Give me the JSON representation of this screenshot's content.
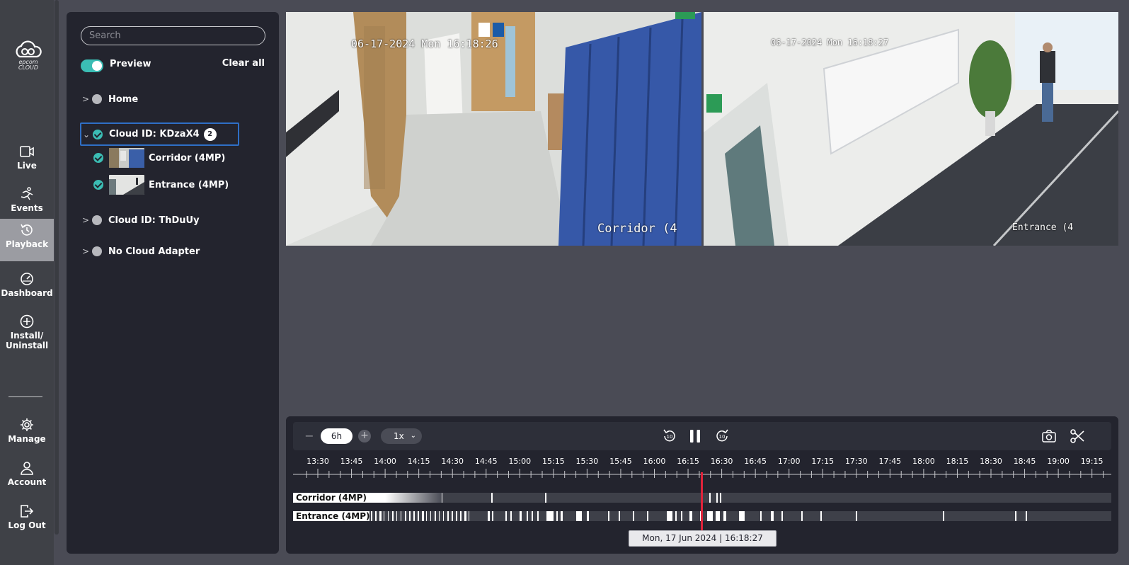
{
  "app": {
    "logo_text": "epcom CLOUD"
  },
  "nav": {
    "items": [
      {
        "label": "Live",
        "icon": "camera-icon"
      },
      {
        "label": "Events",
        "icon": "running-person-icon"
      },
      {
        "label": "Playback",
        "icon": "history-icon",
        "active": true
      },
      {
        "label": "Dashboard",
        "icon": "gauge-icon"
      },
      {
        "label": "Install/ Uninstall",
        "icon": "plus-circle-icon"
      },
      {
        "label": "Manage",
        "icon": "gear-icon"
      },
      {
        "label": "Account",
        "icon": "user-icon"
      },
      {
        "label": "Log Out",
        "icon": "logout-icon"
      }
    ]
  },
  "panel": {
    "search_placeholder": "Search",
    "preview_label": "Preview",
    "preview_on": true,
    "clear_all": "Clear all",
    "groups": [
      {
        "label": "Home",
        "expanded": false,
        "checked": false
      },
      {
        "label": "Cloud ID: KDzaX4",
        "expanded": true,
        "checked": true,
        "count": "2"
      },
      {
        "label": "Cloud ID: ThDuUy",
        "expanded": false,
        "checked": false
      },
      {
        "label": "No Cloud Adapter",
        "expanded": false,
        "checked": false
      }
    ],
    "cameras": [
      {
        "label": "Corridor (4MP)",
        "checked": true
      },
      {
        "label": "Entrance (4MP)",
        "checked": true
      }
    ]
  },
  "tiles": [
    {
      "timestamp": "06-17-2024 Mon 16:18:26",
      "name_overlay": "Corridor (4"
    },
    {
      "timestamp": "06-17-2024 Mon 16:18:27",
      "name_overlay": "Entrance (4"
    }
  ],
  "timeline": {
    "zoom": "6h",
    "speed": "1x",
    "ticks": [
      "13:30",
      "13:45",
      "14:00",
      "14:15",
      "14:30",
      "14:45",
      "15:00",
      "15:15",
      "15:30",
      "15:45",
      "16:00",
      "16:15",
      "16:30",
      "16:45",
      "17:00",
      "17:15",
      "17:30",
      "17:45",
      "18:00",
      "18:15",
      "18:30",
      "18:45",
      "19:00",
      "19:15"
    ],
    "tracks": [
      {
        "label": "Corridor (4MP)"
      },
      {
        "label": "Entrance (4MP)"
      }
    ],
    "current_time": "Mon, 17 Jun 2024 | 16:18:27",
    "playhead_color": "#e0243b"
  },
  "colors": {
    "accent": "#3bbdb4",
    "selection": "#2f6fc6"
  }
}
